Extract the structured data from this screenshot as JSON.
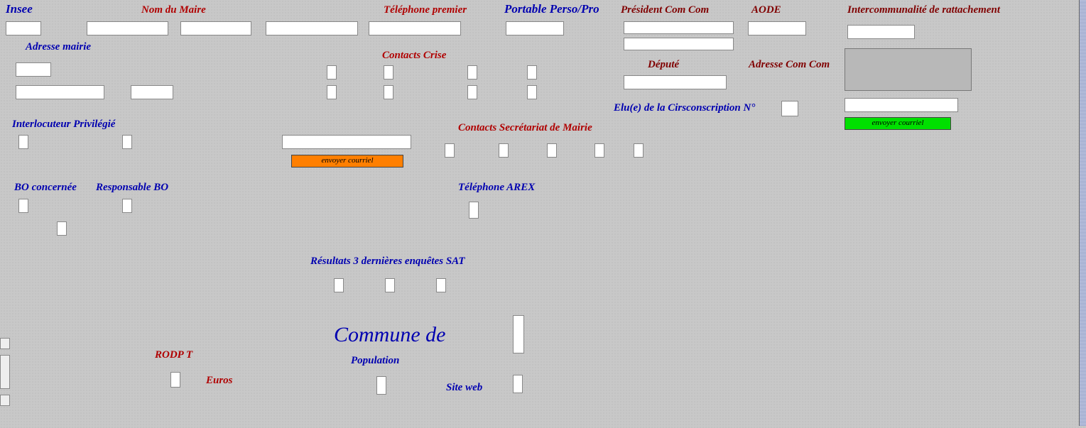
{
  "labels": {
    "insee": "Insee",
    "nom_maire": "Nom du Maire",
    "tel_premier": "Téléphone premier",
    "portable": "Portable Perso/Pro",
    "pres_comcom": "Président Com Com",
    "aode": "AODE",
    "intercomm": "Intercommunalité de rattachement",
    "adresse_mairie": "Adresse mairie",
    "contacts_crise": "Contacts Crise",
    "depute": "Député",
    "adresse_comcom": "Adresse Com Com",
    "elu_circ": "Elu(e) de la Cirsconscription N°",
    "interloc": "Interlocuteur Privilégié",
    "contacts_sec": "Contacts Secrétariat de Mairie",
    "bo_conc": "BO concernée",
    "resp_bo": "Responsable BO",
    "tel_arex": "Téléphone AREX",
    "rodp": "RODP T",
    "euros": "Euros",
    "resultats_sat": "Résultats 3 dernières enquêtes SAT",
    "commune_de": "Commune de",
    "population": "Population",
    "site_web": "Site web"
  },
  "buttons": {
    "envoyer1": "envoyer courriel",
    "envoyer2": "envoyer courriel"
  }
}
